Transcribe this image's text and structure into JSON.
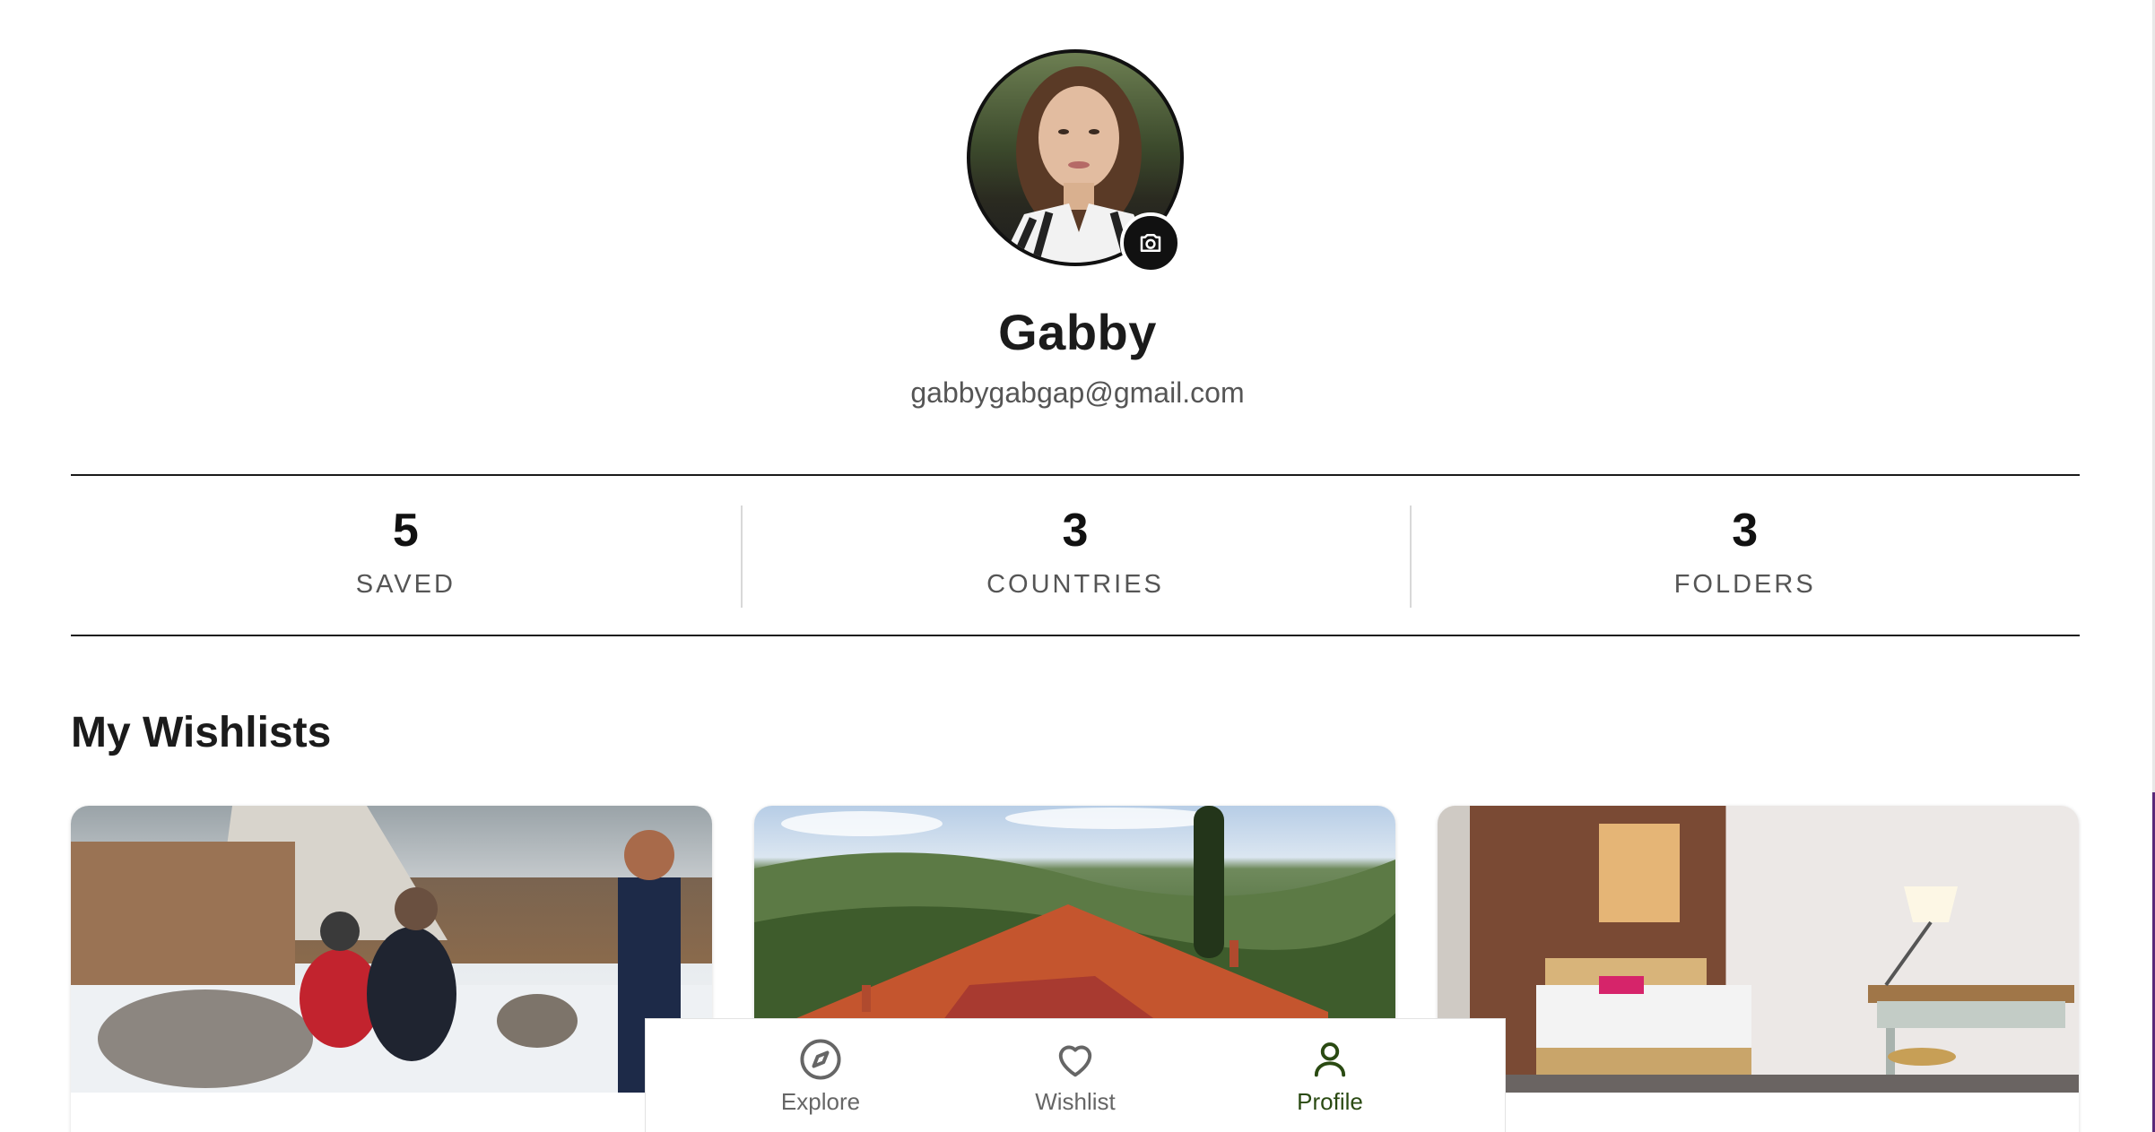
{
  "profile": {
    "name": "Gabby",
    "email": "gabbygabgap@gmail.com"
  },
  "stats": [
    {
      "value": "5",
      "label": "SAVED"
    },
    {
      "value": "3",
      "label": "COUNTRIES"
    },
    {
      "value": "3",
      "label": "FOLDERS"
    }
  ],
  "wishlists": {
    "title": "My Wishlists",
    "cards": [
      {
        "image": "snowy-reindeer-camp-photo"
      },
      {
        "image": "tuscan-hills-rooftop-photo"
      },
      {
        "image": "brick-wall-bedroom-photo"
      }
    ]
  },
  "nav": {
    "items": [
      {
        "label": "Explore",
        "icon": "compass-icon",
        "active": false
      },
      {
        "label": "Wishlist",
        "icon": "heart-icon",
        "active": false
      },
      {
        "label": "Profile",
        "icon": "person-icon",
        "active": true
      }
    ]
  },
  "colors": {
    "text": "#1a1a1a",
    "muted": "#555555",
    "nav_active": "#2a4a12",
    "nav_inactive": "#666666"
  }
}
